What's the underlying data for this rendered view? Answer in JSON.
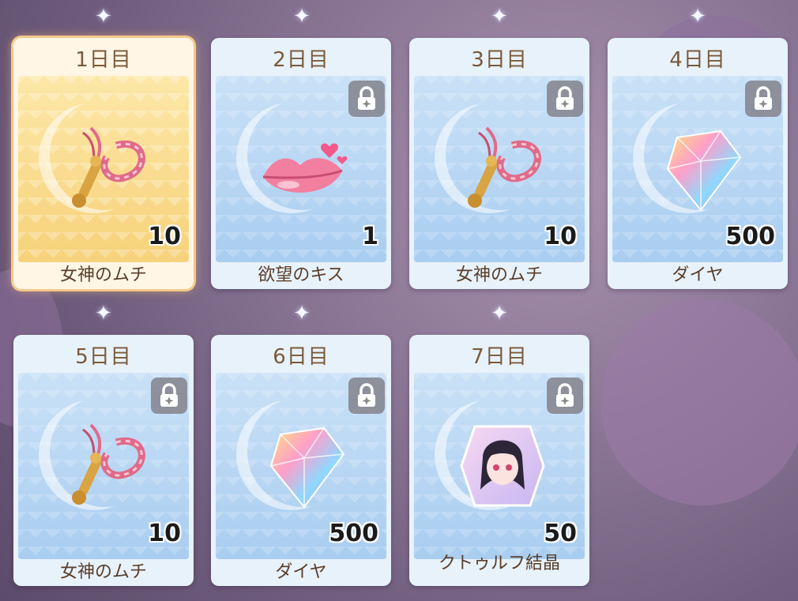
{
  "cards": [
    {
      "day": "1日目",
      "name": "女神のムチ",
      "qty": "10",
      "locked": false,
      "icon": "whip-icon"
    },
    {
      "day": "2日目",
      "name": "欲望のキス",
      "qty": "1",
      "locked": true,
      "icon": "kiss-lips-icon"
    },
    {
      "day": "3日目",
      "name": "女神のムチ",
      "qty": "10",
      "locked": true,
      "icon": "whip-icon"
    },
    {
      "day": "4日目",
      "name": "ダイヤ",
      "qty": "500",
      "locked": true,
      "icon": "diamond-icon"
    },
    {
      "day": "5日目",
      "name": "女神のムチ",
      "qty": "10",
      "locked": true,
      "icon": "whip-icon"
    },
    {
      "day": "6日目",
      "name": "ダイヤ",
      "qty": "500",
      "locked": true,
      "icon": "diamond-icon"
    },
    {
      "day": "7日目",
      "name": "クトゥルフ結晶",
      "qty": "50",
      "locked": true,
      "icon": "character-crystal-icon"
    }
  ],
  "colors": {
    "active_border": "#f4c98a",
    "card_bg": "#e8f2fb",
    "text_brown": "#7a5a3a"
  }
}
